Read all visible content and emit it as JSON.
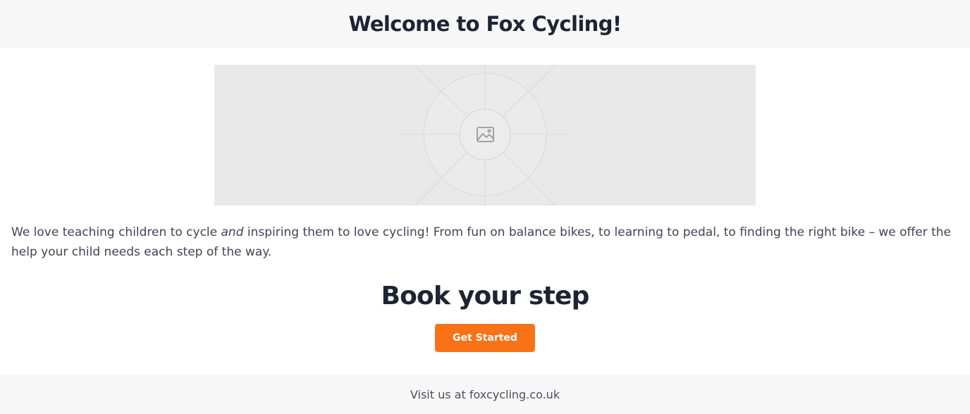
{
  "header": {
    "title": "Welcome to Fox Cycling!"
  },
  "hero": {
    "icon": "image-placeholder-icon",
    "background_color": "#e9e9e9"
  },
  "intro": {
    "before": "We love teaching children to cycle ",
    "emphasis": "and",
    "after": " inspiring them to love cycling! From fun on balance bikes, to learning to pedal, to finding the right bike – we offer the help your child needs each step of the way."
  },
  "booking": {
    "title": "Book your step",
    "button_label": "Get Started"
  },
  "footer": {
    "text": "Visit us at foxcycling.co.uk"
  },
  "colors": {
    "accent": "#f97316",
    "heading": "#1f2433",
    "body_text": "#3f4555",
    "band_background": "#f7f7f7"
  }
}
